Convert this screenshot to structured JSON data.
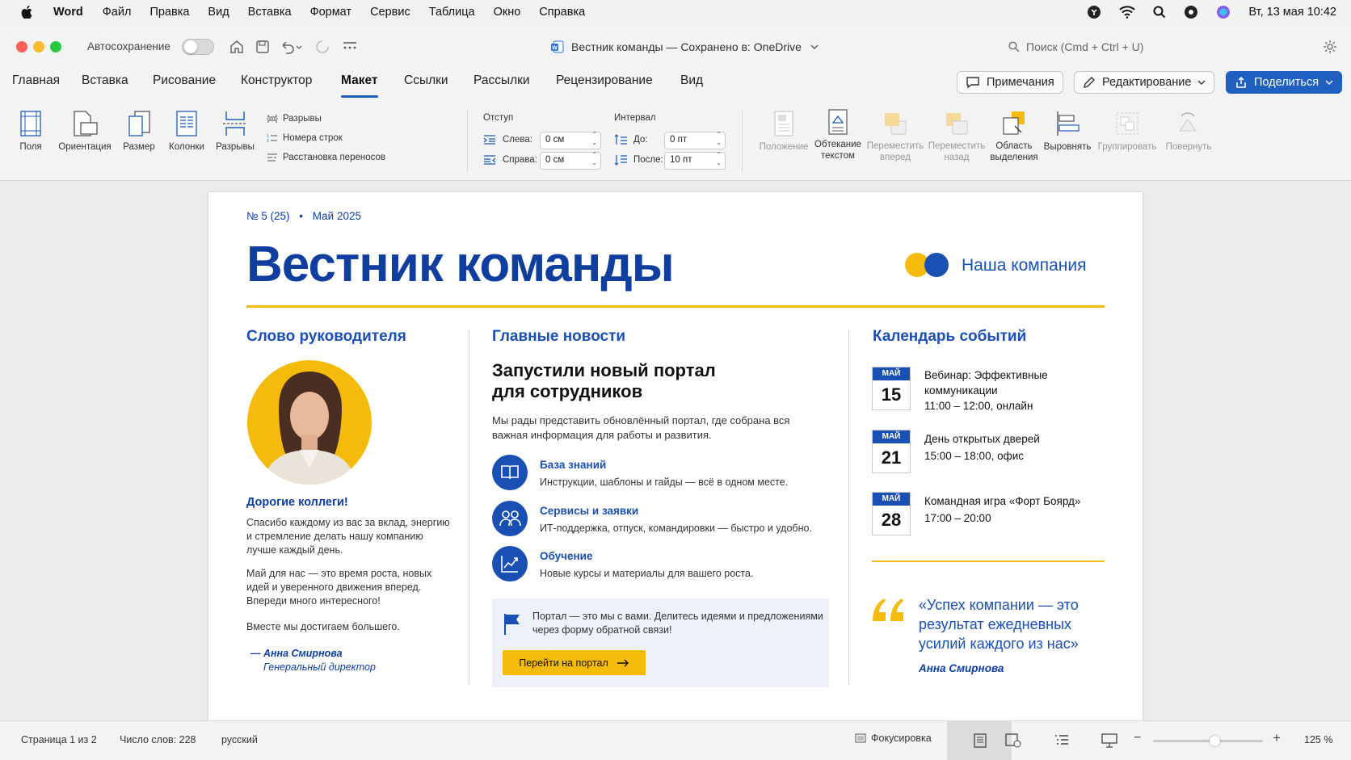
{
  "menubar": {
    "app": "Word",
    "items": [
      "Файл",
      "Правка",
      "Вид",
      "Вставка",
      "Формат",
      "Сервис",
      "Таблица",
      "Окно",
      "Справка"
    ],
    "datetime": "Вт, 13 мая  10:42"
  },
  "titlebar": {
    "autosave_label": "Автосохранение",
    "doc_title": "Вестник команды — Сохранено в: OneDrive",
    "search_placeholder": "Поиск (Cmd + Ctrl + U)"
  },
  "tabs": [
    "Главная",
    "Вставка",
    "Рисование",
    "Конструктор",
    "Макет",
    "Ссылки",
    "Рассылки",
    "Рецензирование",
    "Вид"
  ],
  "active_tab": "Макет",
  "actions": {
    "comments": "Примечания",
    "editing": "Редактирование",
    "share": "Поделиться"
  },
  "ribbon": {
    "fields": "Поля",
    "orientation": "Ориентация",
    "size": "Размер",
    "columns": "Колонки",
    "breaks": "Разрывы",
    "breaks_menu": "Разрывы",
    "line_numbers": "Номера строк",
    "hyphenation": "Расстановка переносов",
    "indent_title": "Отступ",
    "indent_left_label": "Слева:",
    "indent_left_value": "0 см",
    "indent_right_label": "Справа:",
    "indent_right_value": "0 см",
    "spacing_title": "Интервал",
    "spacing_before_label": "До:",
    "spacing_before_value": "0 пт",
    "spacing_after_label": "После:",
    "spacing_after_value": "10 пт",
    "position": "Положение",
    "wrap_1": "Обтекание",
    "wrap_2": "текстом",
    "forward_1": "Переместить",
    "forward_2": "вперед",
    "backward_1": "Переместить",
    "backward_2": "назад",
    "selection_1": "Область",
    "selection_2": "выделения",
    "align": "Выровнять",
    "group": "Группировать",
    "rotate": "Повернуть"
  },
  "doc": {
    "issue": "№ 5 (25)",
    "issue_sep": "•",
    "issue_date": "Май 2025",
    "title": "Вестник команды",
    "company": "Наша компания",
    "colors": {
      "blue": "#0f3e9e",
      "accent_blue": "#1a4fb3",
      "yellow": "#f5bb0b"
    },
    "leader": {
      "heading": "Слово руководителя",
      "greeting": "Дорогие коллеги!",
      "p1": "Спасибо каждому из вас за вклад, энергию и стремление делать нашу компанию лучше каждый день.",
      "p2": "Май для нас — это время роста, новых идей и уверенного движения вперед. Впереди много интересного!",
      "p3": "Вместе мы достигаем большего.",
      "sign_name": "— Анна Смирнова",
      "sign_role": "Генеральный директор"
    },
    "news": {
      "heading": "Главные новости",
      "title_1": "Запустили новый портал",
      "title_2": "для сотрудников",
      "intro": "Мы рады представить обновлённый портал, где собрана вся важная информация для работы и развития.",
      "items": [
        {
          "title": "База знаний",
          "text": "Инструкции, шаблоны и гайды — всё в одном месте.",
          "icon": "book-icon"
        },
        {
          "title": "Сервисы и заявки",
          "text": "ИТ-поддержка, отпуск, командировки — быстро и удобно.",
          "icon": "people-icon"
        },
        {
          "title": "Обучение",
          "text": "Новые курсы и материалы для вашего роста.",
          "icon": "chart-icon"
        }
      ],
      "callout": "Портал — это мы с вами. Делитесь идеями и предложениями через форму обратной связи!",
      "button": "Перейти на портал"
    },
    "calendar": {
      "heading": "Календарь событий",
      "events": [
        {
          "month": "МАЙ",
          "day": "15",
          "title_1": "Вебинар: Эффективные",
          "title_2": "коммуникации",
          "time": "11:00 – 12:00, онлайн"
        },
        {
          "month": "МАЙ",
          "day": "21",
          "title_1": "День открытых дверей",
          "title_2": "",
          "time": "15:00 – 18:00, офис"
        },
        {
          "month": "МАЙ",
          "day": "28",
          "title_1": "Командная игра «Форт Боярд»",
          "title_2": "",
          "time": "17:00 – 20:00"
        }
      ],
      "quote_1": "«Успех компании — это",
      "quote_2": "результат ежедневных",
      "quote_3": "усилий каждого из нас»",
      "quote_author": "Анна Смирнова"
    }
  },
  "status": {
    "page": "Страница 1 из 2",
    "words": "Число слов: 228",
    "lang": "русский",
    "focus": "Фокусировка",
    "zoom": "125 %"
  }
}
